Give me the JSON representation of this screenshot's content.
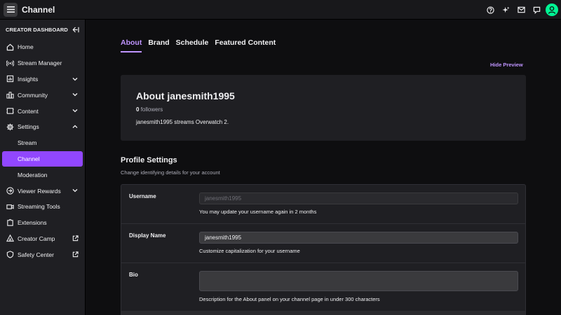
{
  "topbar": {
    "title": "Channel",
    "icons": [
      "help-icon",
      "sparkle-icon",
      "mail-icon",
      "chat-icon",
      "avatar"
    ]
  },
  "sidebar": {
    "header": "CREATOR DASHBOARD",
    "items": [
      {
        "label": "Home",
        "icon": "home-icon"
      },
      {
        "label": "Stream Manager",
        "icon": "broadcast-icon"
      },
      {
        "label": "Insights",
        "icon": "chart-icon",
        "expand": "down"
      },
      {
        "label": "Community",
        "icon": "community-icon",
        "expand": "down"
      },
      {
        "label": "Content",
        "icon": "content-icon",
        "expand": "down"
      },
      {
        "label": "Settings",
        "icon": "gear-icon",
        "expand": "up"
      },
      {
        "label": "Stream",
        "sub": true
      },
      {
        "label": "Channel",
        "sub": true,
        "active": true
      },
      {
        "label": "Moderation",
        "sub": true
      },
      {
        "label": "Viewer Rewards",
        "icon": "rewards-icon",
        "expand": "down"
      },
      {
        "label": "Streaming Tools",
        "icon": "camera-icon"
      },
      {
        "label": "Extensions",
        "icon": "extensions-icon"
      },
      {
        "label": "Creator Camp",
        "icon": "creator-camp-icon",
        "external": true
      },
      {
        "label": "Safety Center",
        "icon": "safety-icon",
        "external": true
      }
    ]
  },
  "tabs": [
    "About",
    "Brand",
    "Schedule",
    "Featured Content"
  ],
  "hide_preview": "Hide Preview",
  "about": {
    "title": "About janesmith1995",
    "followers_count": "0",
    "followers_label": "followers",
    "description": "janesmith1995 streams Overwatch 2."
  },
  "profile_settings": {
    "title": "Profile Settings",
    "subtitle": "Change identifying details for your account",
    "username": {
      "label": "Username",
      "placeholder": "janesmith1995",
      "hint": "You may update your username again in 2 months"
    },
    "display_name": {
      "label": "Display Name",
      "value": "janesmith1995",
      "hint": "Customize capitalization for your username"
    },
    "bio": {
      "label": "Bio",
      "value": "",
      "hint": "Description for the About panel on your channel page in under 300 characters"
    }
  },
  "colors": {
    "accent": "#9147ff",
    "accent_text": "#bf94ff",
    "avatar": "#00f593"
  }
}
